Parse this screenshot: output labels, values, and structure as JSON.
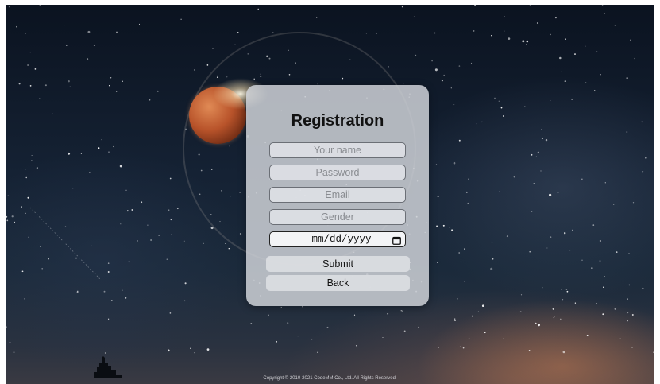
{
  "registration": {
    "title": "Registration",
    "name_placeholder": "Your name",
    "password_placeholder": "Password",
    "email_placeholder": "Email",
    "gender_placeholder": "Gender",
    "date_placeholder": "mm/dd/yyyy",
    "submit_label": "Submit",
    "back_label": "Back"
  },
  "footer": {
    "copyright": "Copyright © 2010-2021 CodeMM Co., Ltd. All Rights Reserved."
  },
  "icons": {
    "calendar": "calendar-icon"
  },
  "colors": {
    "card_bg": "#cdd0d6",
    "sky_top": "#0b1320",
    "planet": "#b8532a"
  }
}
